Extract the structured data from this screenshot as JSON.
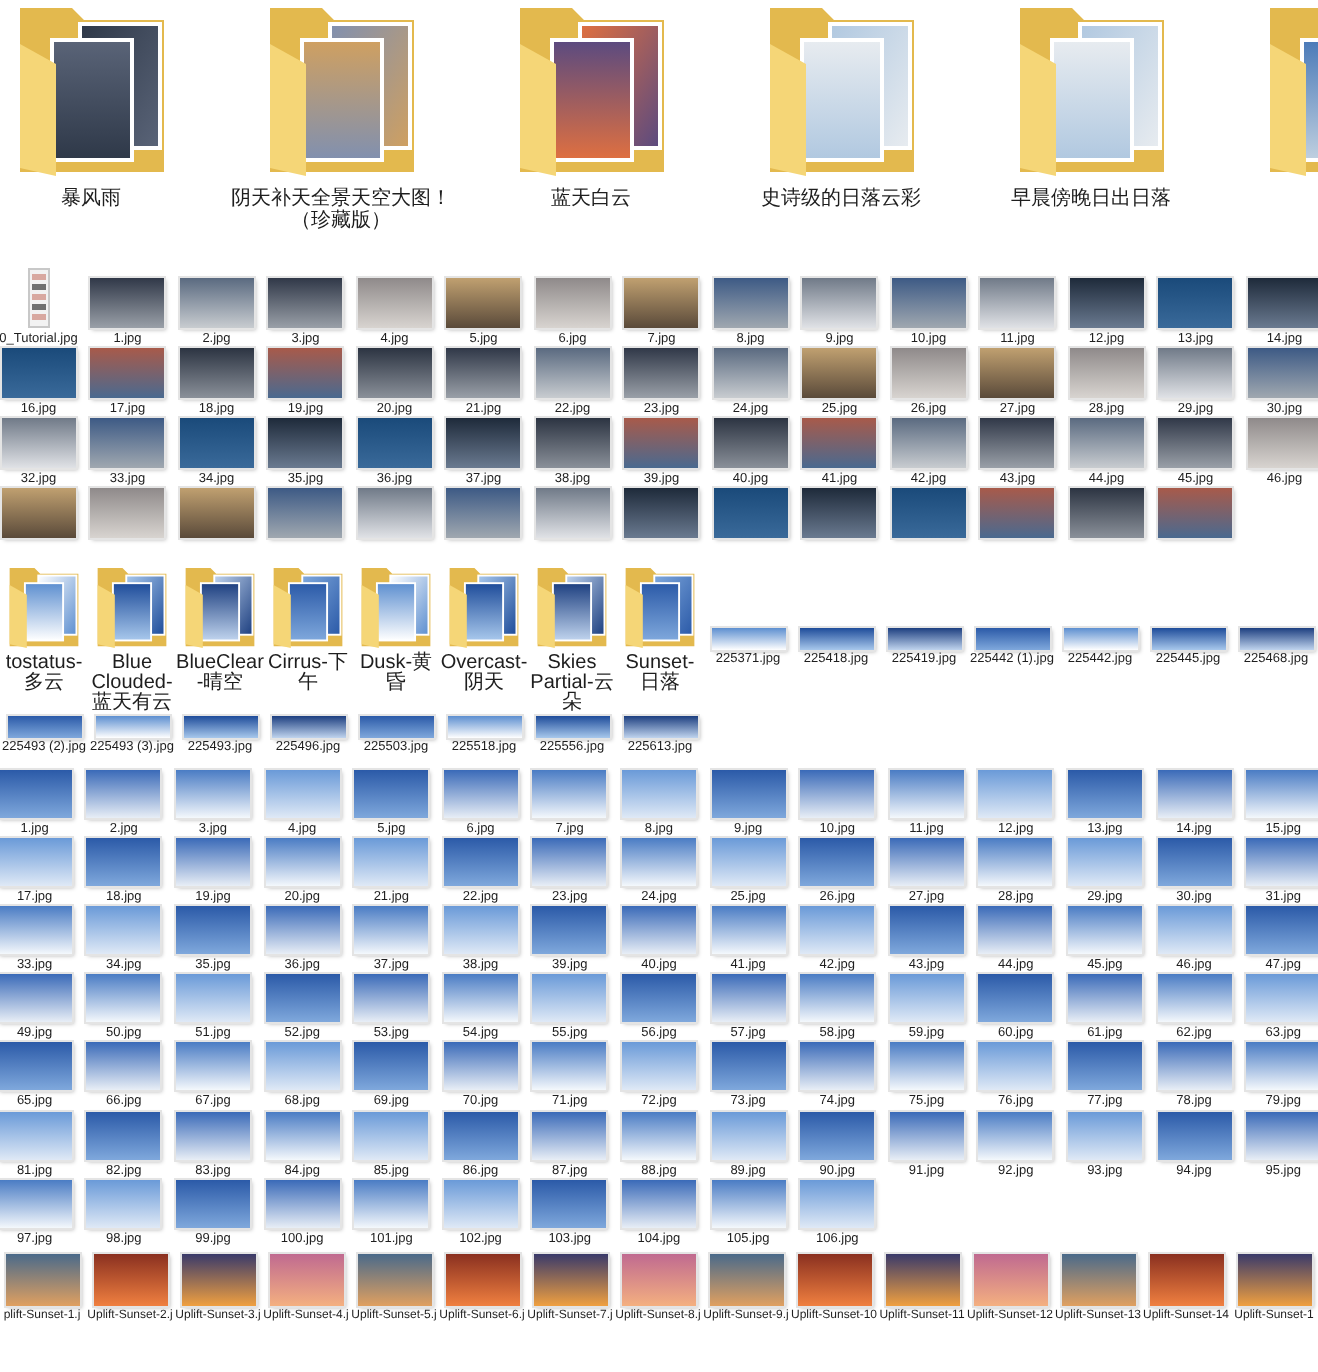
{
  "sections": [
    {
      "kind": "folder",
      "items": [
        {
          "name": "暴风雨"
        },
        {
          "name": "阴天补天全景天空大图！（珍藏版）"
        },
        {
          "name": "蓝天白云"
        },
        {
          "name": "史诗级的日落云彩"
        },
        {
          "name": "早晨傍晚日出日落"
        },
        {
          "kind": "folder"
        }
      ]
    },
    {
      "kind": "photo",
      "items": [
        {
          "kind": "document",
          "name": "0_Tutorial.jpg"
        },
        "1.jpg",
        "2.jpg",
        "3.jpg",
        "4.jpg",
        "5.jpg",
        "6.jpg",
        "7.jpg",
        "8.jpg",
        "9.jpg",
        "10.jpg",
        "11.jpg",
        "12.jpg",
        "13.jpg",
        "14.jpg",
        "16.jpg",
        "17.jpg",
        "18.jpg",
        "19.jpg",
        "20.jpg",
        "21.jpg",
        "22.jpg",
        "23.jpg",
        "24.jpg",
        "25.jpg",
        "26.jpg",
        "27.jpg",
        "28.jpg",
        "29.jpg",
        "30.jpg",
        "32.jpg",
        "33.jpg",
        "34.jpg",
        "35.jpg",
        "36.jpg",
        "37.jpg",
        "38.jpg",
        "39.jpg",
        "40.jpg",
        "41.jpg",
        "42.jpg",
        "43.jpg",
        "44.jpg",
        "45.jpg",
        "46.jpg",
        {
          "kind": "photo"
        },
        {
          "kind": "photo"
        },
        {
          "kind": "photo"
        },
        {
          "kind": "photo"
        },
        {
          "kind": "photo"
        },
        {
          "kind": "photo"
        },
        {
          "kind": "photo"
        },
        {
          "kind": "photo"
        },
        {
          "kind": "photo"
        },
        {
          "kind": "photo"
        },
        {
          "kind": "photo"
        },
        {
          "kind": "photo"
        },
        {
          "kind": "photo"
        },
        {
          "kind": "photo"
        }
      ]
    },
    {
      "kind": "folder",
      "items": [
        {
          "name": "tostatus-多云"
        },
        {
          "name": "Blue Clouded-蓝天有云"
        },
        {
          "name": "BlueClear-晴空"
        },
        {
          "name": "Cirrus-下午"
        },
        {
          "name": "Dusk-黄昏"
        },
        {
          "name": "Overcast-阴天"
        },
        {
          "name": "Skies Partial-云朵"
        },
        {
          "name": "Sunset-日落"
        },
        {
          "kind": "panorama",
          "name": "225371.jpg"
        },
        {
          "kind": "panorama",
          "name": "225418.jpg"
        },
        {
          "kind": "panorama",
          "name": "225419.jpg"
        },
        {
          "kind": "panorama",
          "name": "225442 (1).jpg"
        },
        {
          "kind": "panorama",
          "name": "225442.jpg"
        },
        {
          "kind": "panorama",
          "name": "225445.jpg"
        },
        {
          "kind": "panorama",
          "name": "225468.jpg"
        },
        {
          "kind": "panorama",
          "name": "225493 (2).jpg"
        },
        {
          "kind": "panorama",
          "name": "225493 (3).jpg"
        },
        {
          "kind": "panorama",
          "name": "225493.jpg"
        },
        {
          "kind": "panorama",
          "name": "225496.jpg"
        },
        {
          "kind": "panorama",
          "name": "225503.jpg"
        },
        {
          "kind": "panorama",
          "name": "225518.jpg"
        },
        {
          "kind": "panorama",
          "name": "225556.jpg"
        },
        {
          "kind": "panorama",
          "name": "225613.jpg"
        }
      ]
    },
    {
      "kind": "photo",
      "items": [
        "1.jpg",
        "2.jpg",
        "3.jpg",
        "4.jpg",
        "5.jpg",
        "6.jpg",
        "7.jpg",
        "8.jpg",
        "9.jpg",
        "10.jpg",
        "11.jpg",
        "12.jpg",
        "13.jpg",
        "14.jpg",
        "15.jpg",
        "17.jpg",
        "18.jpg",
        "19.jpg",
        "20.jpg",
        "21.jpg",
        "22.jpg",
        "23.jpg",
        "24.jpg",
        "25.jpg",
        "26.jpg",
        "27.jpg",
        "28.jpg",
        "29.jpg",
        "30.jpg",
        "31.jpg",
        "33.jpg",
        "34.jpg",
        "35.jpg",
        "36.jpg",
        "37.jpg",
        "38.jpg",
        "39.jpg",
        "40.jpg",
        "41.jpg",
        "42.jpg",
        "43.jpg",
        "44.jpg",
        "45.jpg",
        "46.jpg",
        "47.jpg",
        "49.jpg",
        "50.jpg",
        "51.jpg",
        "52.jpg",
        "53.jpg",
        "54.jpg",
        "55.jpg",
        "56.jpg",
        "57.jpg",
        "58.jpg",
        "59.jpg",
        "60.jpg",
        "61.jpg",
        "62.jpg",
        "63.jpg",
        "65.jpg",
        "66.jpg",
        "67.jpg",
        "68.jpg",
        "69.jpg",
        "70.jpg",
        "71.jpg",
        "72.jpg",
        "73.jpg",
        "74.jpg",
        "75.jpg",
        "76.jpg",
        "77.jpg",
        "78.jpg",
        "79.jpg",
        "81.jpg",
        "82.jpg",
        "83.jpg",
        "84.jpg",
        "85.jpg",
        "86.jpg",
        "87.jpg",
        "88.jpg",
        "89.jpg",
        "90.jpg",
        "91.jpg",
        "92.jpg",
        "93.jpg",
        "94.jpg",
        "95.jpg",
        "97.jpg",
        "98.jpg",
        "99.jpg",
        "100.jpg",
        "101.jpg",
        "102.jpg",
        "103.jpg",
        "104.jpg",
        "105.jpg",
        "106.jpg"
      ]
    },
    {
      "kind": "photo",
      "items": [
        "plift-Sunset-1.j",
        "Uplift-Sunset-2.j",
        "Uplift-Sunset-3.j",
        "Uplift-Sunset-4.j",
        "Uplift-Sunset-5.j",
        "Uplift-Sunset-6.j",
        "Uplift-Sunset-7.j",
        "Uplift-Sunset-8.j",
        "Uplift-Sunset-9.j",
        "Uplift-Sunset-10",
        "Uplift-Sunset-11",
        "Uplift-Sunset-12",
        "Uplift-Sunset-13",
        "Uplift-Sunset-14",
        "Uplift-Sunset-1"
      ]
    }
  ]
}
